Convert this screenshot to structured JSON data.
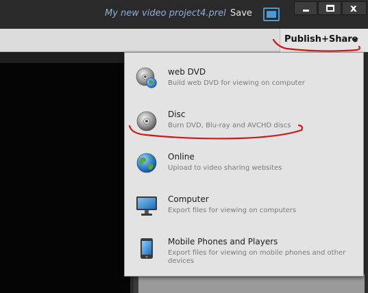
{
  "titlebar": {
    "project_title": "My new video project4.prel",
    "save_label": "Save"
  },
  "window_controls": {
    "close_glyph": "x"
  },
  "toolbar": {
    "publish_label": "Publish+Share"
  },
  "menu": {
    "items": [
      {
        "title": "web DVD",
        "description": "Build web DVD for viewing on computer",
        "icon": "web-dvd-icon"
      },
      {
        "title": "Disc",
        "description": "Burn DVD, Blu-ray and AVCHD discs",
        "icon": "disc-icon"
      },
      {
        "title": "Online",
        "description": "Upload to video sharing websites",
        "icon": "globe-icon"
      },
      {
        "title": "Computer",
        "description": "Export files for viewing on computers",
        "icon": "monitor-icon"
      },
      {
        "title": "Mobile Phones and Players",
        "description": "Export files for viewing on mobile phones and other devices",
        "icon": "mobile-phone-icon"
      }
    ]
  },
  "colors": {
    "accent_blue": "#4a9ad6",
    "annotation_red": "#d11414",
    "project_title": "#8fb1d8"
  }
}
